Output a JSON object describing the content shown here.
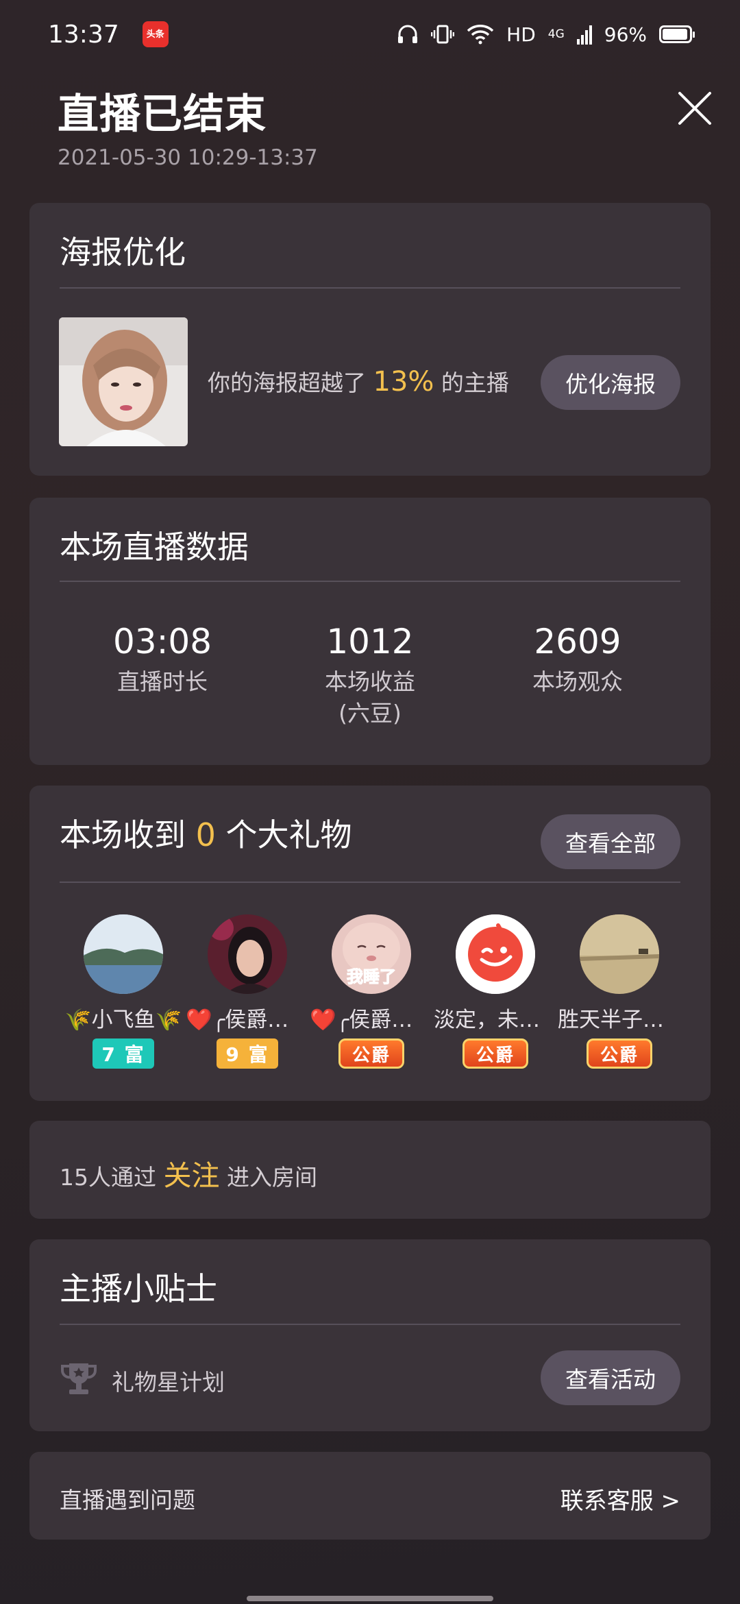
{
  "status_bar": {
    "time": "13:37",
    "app_badge": "头条",
    "hd": "HD",
    "network": "4G",
    "battery": "96%",
    "battery_level": 0.96
  },
  "header": {
    "title": "直播已结束",
    "time_range": "2021-05-30 10:29-13:37"
  },
  "poster": {
    "title": "海报优化",
    "text_before": "你的海报超越了",
    "percent": "13%",
    "text_after": "的主播",
    "button": "优化海报"
  },
  "stats": {
    "title": "本场直播数据",
    "items": [
      {
        "value": "03:08",
        "label": "直播时长",
        "sub": ""
      },
      {
        "value": "1012",
        "label": "本场收益",
        "sub": "(六豆)"
      },
      {
        "value": "2609",
        "label": "本场观众",
        "sub": ""
      }
    ]
  },
  "gifts": {
    "title_before": "本场收到",
    "count": "0",
    "title_after": "个大礼物",
    "button": "查看全部",
    "gifters": [
      {
        "name": "🌾小飞鱼🌾",
        "badge": "7 富"
      },
      {
        "name": "❤️╭侯爵团…",
        "badge": "9 富"
      },
      {
        "name": "❤️╭侯爵团…",
        "badge": "公爵"
      },
      {
        "name": "淡定，未来…",
        "badge": "公爵"
      },
      {
        "name": "胜天半子《…",
        "badge": "公爵"
      }
    ],
    "avatar_overlay_text": "我睡了"
  },
  "follow": {
    "text_before": "15人通过",
    "highlight": "关注",
    "text_after": "进入房间"
  },
  "tips": {
    "title": "主播小贴士",
    "item_label": "礼物星计划",
    "button": "查看活动"
  },
  "help": {
    "label": "直播遇到问题",
    "link": "联系客服 >"
  },
  "colors": {
    "accent": "#f3c04e",
    "card": "#3a3339",
    "pill": "#5a5260"
  }
}
